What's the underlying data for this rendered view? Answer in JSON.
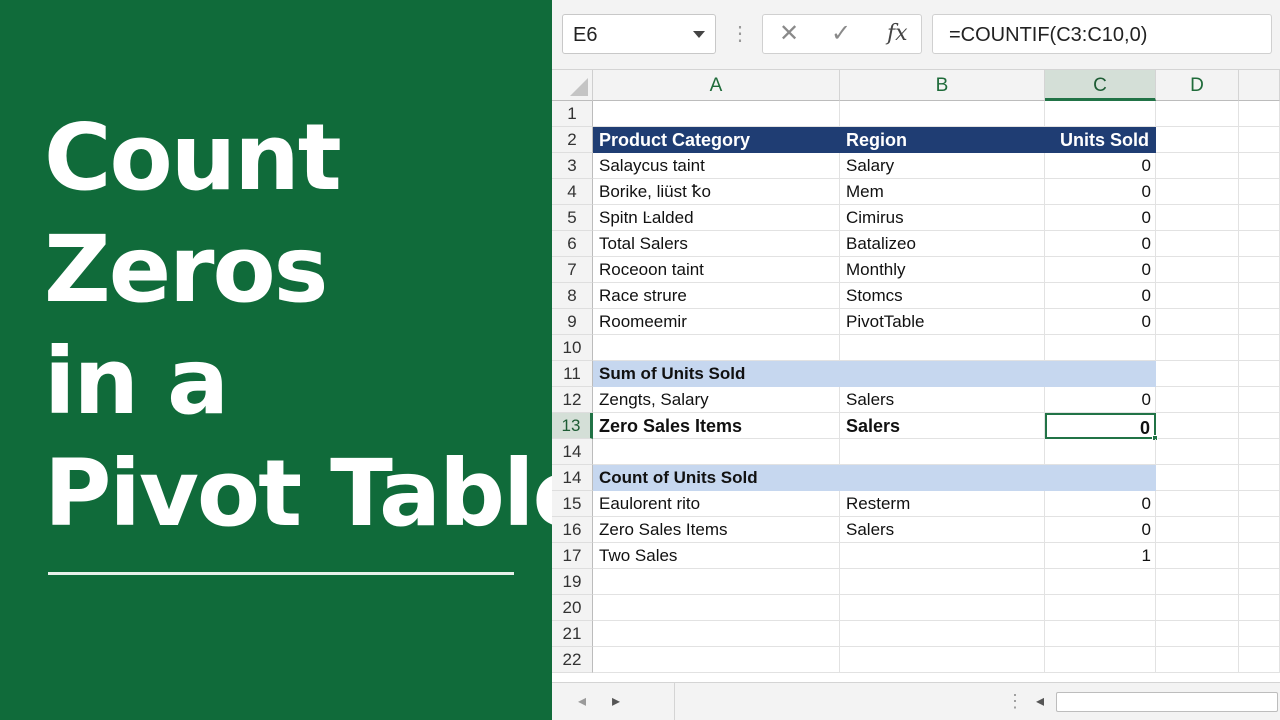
{
  "title": {
    "lines": [
      "Count",
      "Zeros",
      "in a",
      "Pivot Table"
    ]
  },
  "formula_bar": {
    "name_box": "E6",
    "cancel_icon": "✕",
    "enter_icon": "✓",
    "function_icon": "fx",
    "formula": "=COUNTIF(C3:C10,0)"
  },
  "columns": [
    "A",
    "B",
    "C",
    "D"
  ],
  "rows": [
    {
      "num": "1",
      "a": "",
      "b": "",
      "c": ""
    },
    {
      "num": "2",
      "a": "Product Category",
      "b": "Region",
      "c": "Units Sold"
    },
    {
      "num": "3",
      "a": "Salaycus taint",
      "b": "Salary",
      "c": "0"
    },
    {
      "num": "4",
      "a": "Borike, liüst ꝁo",
      "b": "Mem",
      "c": "0"
    },
    {
      "num": "5",
      "a": "Spitn Ŀalded",
      "b": "Cimirus",
      "c": "0"
    },
    {
      "num": "6",
      "a": "Total Salers",
      "b": "Batalizeo",
      "c": "0"
    },
    {
      "num": "7",
      "a": "Roceoon taint",
      "b": "Monthly",
      "c": "0"
    },
    {
      "num": "8",
      "a": "Race strure",
      "b": "Stomcs",
      "c": "0"
    },
    {
      "num": "9",
      "a": "Roomeemir",
      "b": "PivotTable",
      "c": "0"
    },
    {
      "num": "10",
      "a": "",
      "b": "",
      "c": ""
    },
    {
      "num": "11",
      "a": "Sum of Units Sold",
      "b": "",
      "c": ""
    },
    {
      "num": "12",
      "a": "Zengts, Salary",
      "b": "Salers",
      "c": "0"
    },
    {
      "num": "13",
      "a": "Zero Sales Items",
      "b": "Salers",
      "c": "0"
    },
    {
      "num": "14",
      "a": "",
      "b": "",
      "c": ""
    },
    {
      "num": "14",
      "a": "Count of Units Sold",
      "b": "",
      "c": ""
    },
    {
      "num": "15",
      "a": "Eaulorent rito",
      "b": "Resterm",
      "c": "0"
    },
    {
      "num": "16",
      "a": "Zero Sales Items",
      "b": "Salers",
      "c": "0"
    },
    {
      "num": "17",
      "a": "Two Sales",
      "b": "",
      "c": "1"
    },
    {
      "num": "19",
      "a": "",
      "b": "",
      "c": ""
    },
    {
      "num": "20",
      "a": "",
      "b": "",
      "c": ""
    },
    {
      "num": "21",
      "a": "",
      "b": "",
      "c": ""
    },
    {
      "num": "22",
      "a": "",
      "b": "",
      "c": ""
    }
  ],
  "bottom_bar": {
    "prev_icon": "◂",
    "next_icon": "▸",
    "dots": "⋮",
    "scroll_left_icon": "◂"
  },
  "colors": {
    "panel_green": "#106b3a",
    "header_navy": "#1f3d73",
    "pivot_blue": "#c6d7ef",
    "excel_accent": "#217346"
  }
}
